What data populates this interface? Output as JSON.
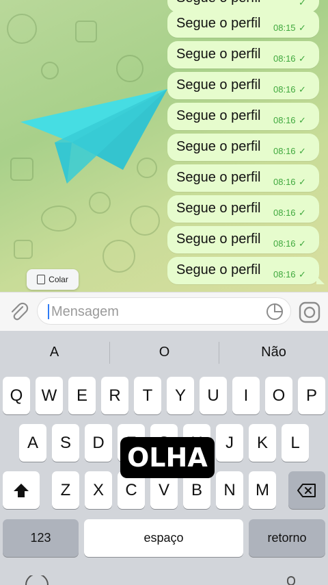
{
  "chat": {
    "messages": [
      {
        "text": "Segue o perfil",
        "time": "",
        "status": "✓"
      },
      {
        "text": "Segue o perfil",
        "time": "08:15",
        "status": "✓"
      },
      {
        "text": "Segue o perfil",
        "time": "08:16",
        "status": "✓"
      },
      {
        "text": "Segue o perfil",
        "time": "08:16",
        "status": "✓"
      },
      {
        "text": "Segue o perfil",
        "time": "08:16",
        "status": "✓"
      },
      {
        "text": "Segue o perfil",
        "time": "08:16",
        "status": "✓"
      },
      {
        "text": "Segue o perfil",
        "time": "08:16",
        "status": "✓"
      },
      {
        "text": "Segue o perfil",
        "time": "08:16",
        "status": "✓"
      },
      {
        "text": "Segue o perfil",
        "time": "08:16",
        "status": "✓"
      },
      {
        "text": "Segue o perfil",
        "time": "08:16",
        "status": "✓"
      }
    ],
    "paste_label": "Colar"
  },
  "input": {
    "placeholder": "Mensagem",
    "value": ""
  },
  "keyboard": {
    "suggestions": [
      "A",
      "O",
      "Não"
    ],
    "row1": [
      "Q",
      "W",
      "E",
      "R",
      "T",
      "Y",
      "U",
      "I",
      "O",
      "P"
    ],
    "row2": [
      "A",
      "S",
      "D",
      "F",
      "G",
      "H",
      "J",
      "K",
      "L"
    ],
    "row3": [
      "Z",
      "X",
      "C",
      "V",
      "B",
      "N",
      "M"
    ],
    "numbers_label": "123",
    "space_label": "espaço",
    "return_label": "retorno",
    "shift_icon": "shift-icon",
    "backspace_icon": "backspace-icon"
  },
  "overlay_caption": "OLHA",
  "colors": {
    "bubble": "#e6fccd",
    "time_green": "#3fa83d",
    "plane": "#3fd6dc",
    "keyboard_bg": "#d2d5da"
  }
}
